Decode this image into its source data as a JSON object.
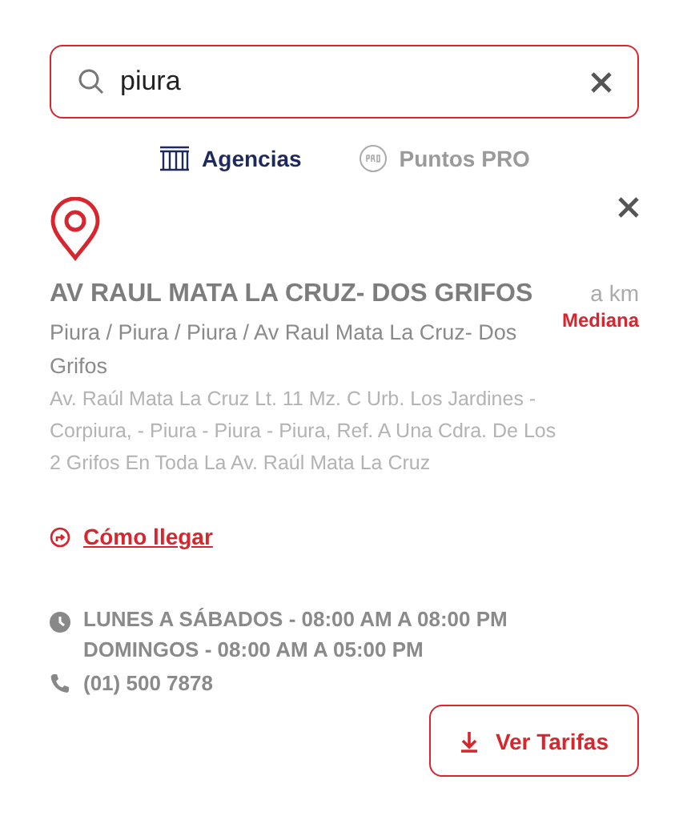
{
  "search": {
    "value": "piura"
  },
  "tabs": [
    {
      "label": "Agencias",
      "kind": "building",
      "selected": true
    },
    {
      "label": "Puntos PRO",
      "kind": "pro",
      "selected": false
    }
  ],
  "agency": {
    "name": "AV RAUL MATA LA CRUZ- DOS GRIFOS",
    "distance": "a km",
    "size": "Mediana",
    "location": "Piura / Piura / Piura / Av Raul Mata La Cruz- Dos Grifos",
    "address": "Av. Raúl Mata La Cruz Lt. 11 Mz. C Urb. Los Jardines - Corpiura, - Piura - Piura - Piura, Ref. A Una Cdra. De Los 2 Grifos En Toda La Av. Raúl Mata La Cruz",
    "directions": "Cómo llegar",
    "hours": [
      "LUNES A SÁBADOS - 08:00 AM A 08:00 PM",
      "DOMINGOS - 08:00 AM A 05:00 PM"
    ],
    "phone": "(01) 500 7878",
    "button": "Ver Tarifas"
  }
}
